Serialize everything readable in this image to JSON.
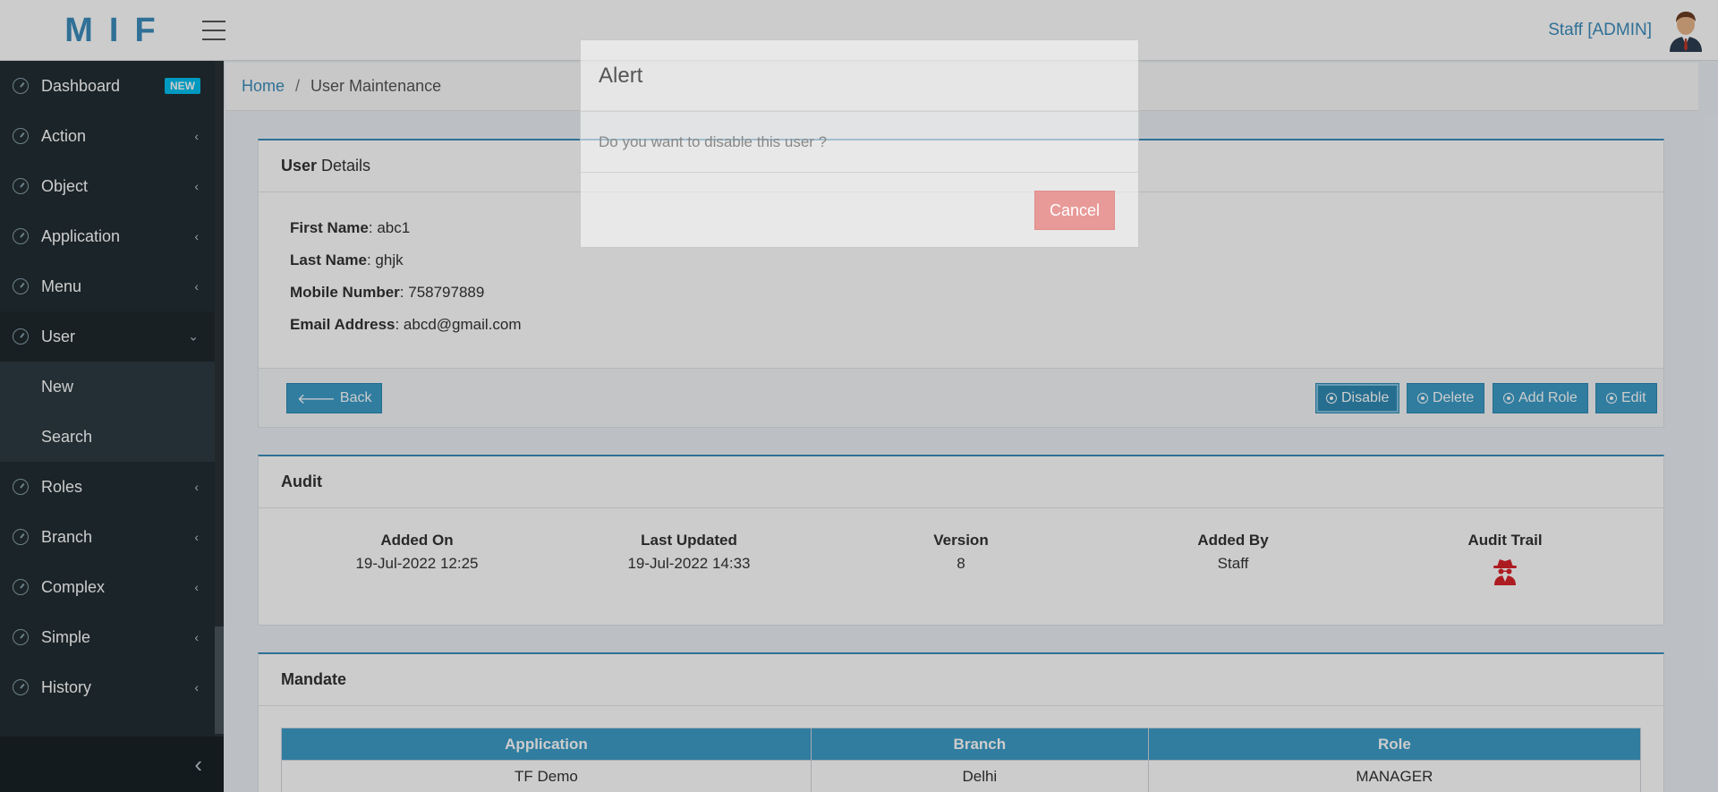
{
  "header": {
    "logo": "MIF",
    "user_name": "Staff [ADMIN]"
  },
  "sidebar": {
    "items": [
      {
        "label": "Dashboard",
        "badge": "NEW"
      },
      {
        "label": "Action"
      },
      {
        "label": "Object"
      },
      {
        "label": "Application"
      },
      {
        "label": "Menu"
      },
      {
        "label": "User",
        "expanded": true,
        "children": [
          "New",
          "Search"
        ]
      },
      {
        "label": "Roles"
      },
      {
        "label": "Branch"
      },
      {
        "label": "Complex"
      },
      {
        "label": "Simple"
      },
      {
        "label": "History"
      }
    ]
  },
  "breadcrumb": {
    "home": "Home",
    "separator": "/",
    "current": "User Maintenance"
  },
  "user_details": {
    "title_bold": "User",
    "title_rest": " Details",
    "fields": [
      {
        "label": "First Name",
        "value": ": abc1"
      },
      {
        "label": "Last Name",
        "value": ": ghjk"
      },
      {
        "label": "Mobile Number",
        "value": ": 758797889"
      },
      {
        "label": "Email Address",
        "value": ": abcd@gmail.com"
      }
    ],
    "buttons": {
      "back": "Back",
      "disable": "Disable",
      "delete": "Delete",
      "add_role": "Add Role",
      "edit": "Edit"
    }
  },
  "audit": {
    "title": "Audit",
    "columns": [
      {
        "heading": "Added On",
        "value": "19-Jul-2022 12:25"
      },
      {
        "heading": "Last Updated",
        "value": "19-Jul-2022 14:33"
      },
      {
        "heading": "Version",
        "value": "8"
      },
      {
        "heading": "Added By",
        "value": "Staff"
      },
      {
        "heading": "Audit Trail",
        "icon": "spy-icon"
      }
    ]
  },
  "mandate": {
    "title": "Mandate",
    "headers": [
      "Application",
      "Branch",
      "Role"
    ],
    "rows": [
      [
        "TF Demo",
        "Delhi",
        "MANAGER"
      ]
    ]
  },
  "modal": {
    "title": "Alert",
    "message": "Do you want to disable this user ?",
    "cancel": "Cancel"
  },
  "colors": {
    "accent": "#3c8dbc",
    "sidebar_bg": "#222d32",
    "button": "#3c9dc8",
    "cancel": "#e89a98",
    "spy_icon": "#d9232a"
  }
}
